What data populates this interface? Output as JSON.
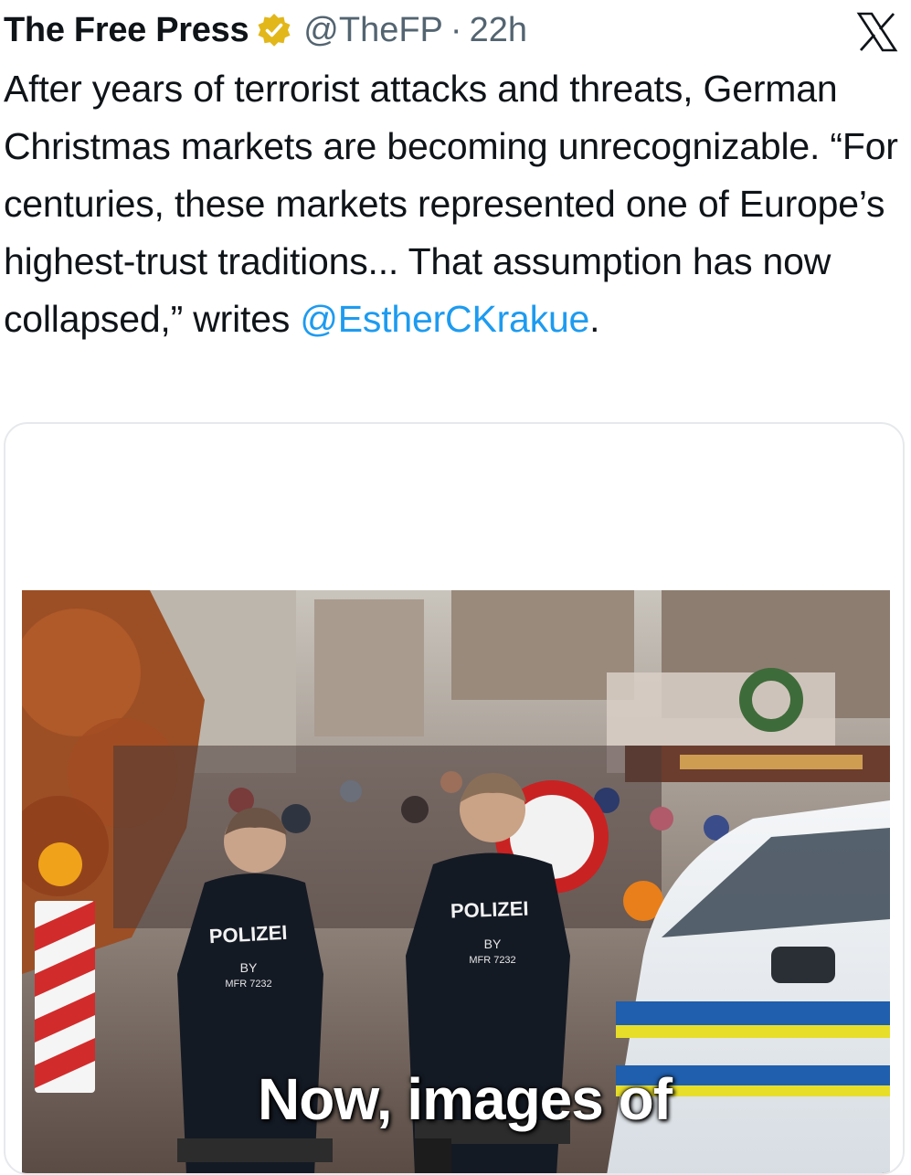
{
  "tweet": {
    "display_name": "The Free Press",
    "handle": "@TheFP",
    "separator": "·",
    "time": "22h",
    "verified_icon": "gold-verified-badge",
    "platform_icon": "x-logo",
    "text_part1": "After years of terrorist attacks and threats, German Christmas markets are becoming unrecognizable. “For centuries, these markets represented one of Europe’s highest-trust traditions... That assumption has now collapsed,” writes ",
    "mention": "@EstherCKrakue",
    "text_part2": "."
  },
  "card": {
    "image_caption": "Now, images of",
    "jacket_left_title": "POLIZEI",
    "jacket_left_sub1": "BY",
    "jacket_left_sub2": "MFR 7232",
    "jacket_right_title": "POLIZEI",
    "jacket_right_sub1": "BY",
    "jacket_right_sub2": "MFR 7232"
  },
  "colors": {
    "mention": "#1d9bf0",
    "muted": "#536471",
    "badge_gold": "#e2b719",
    "police_blue": "#1f5fae",
    "police_yellow": "#e7de2a"
  }
}
